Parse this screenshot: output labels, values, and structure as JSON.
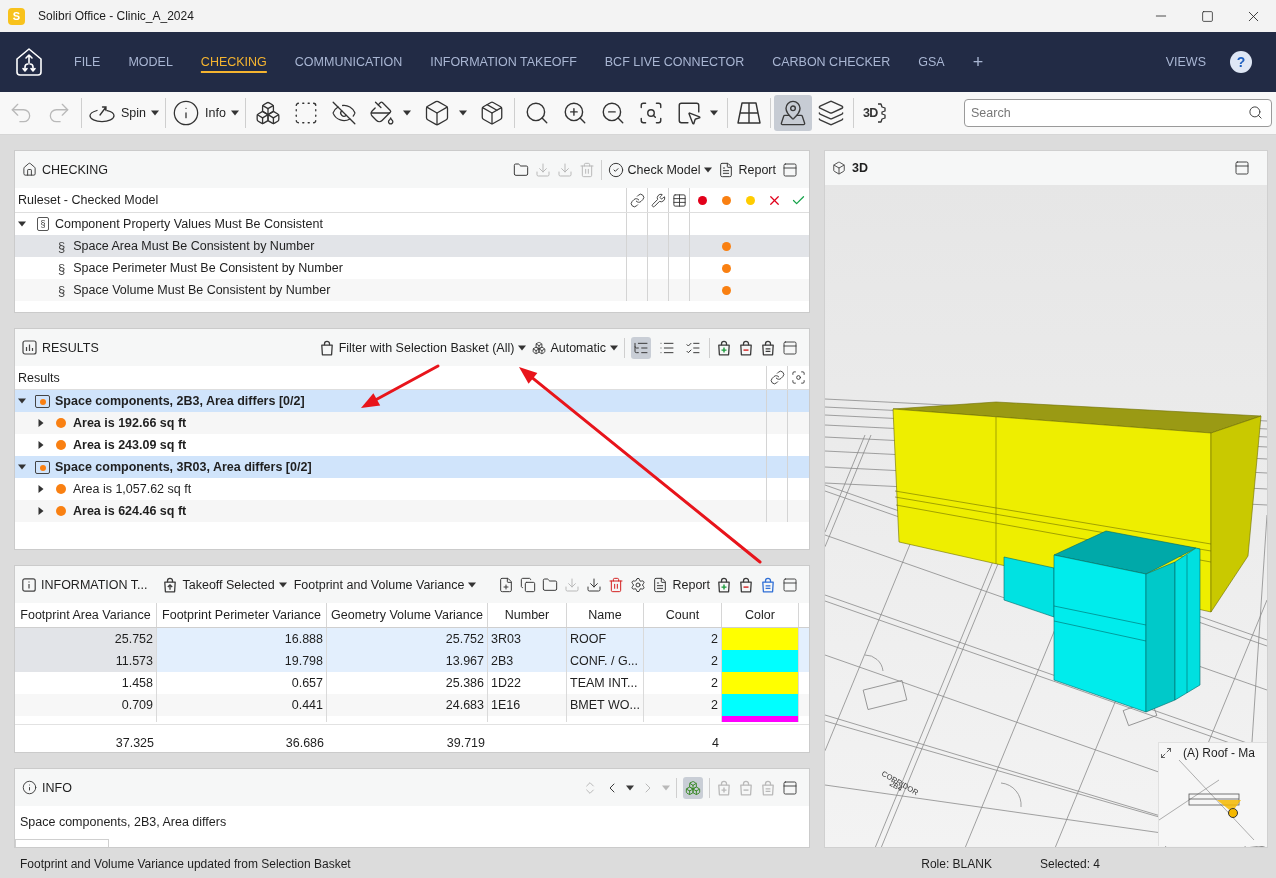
{
  "window": {
    "app_badge": "S",
    "title": "Solibri Office - Clinic_A_2024"
  },
  "menu": {
    "items": [
      {
        "label": "FILE",
        "selected": false
      },
      {
        "label": "MODEL",
        "selected": false
      },
      {
        "label": "CHECKING",
        "selected": true
      },
      {
        "label": "COMMUNICATION",
        "selected": false
      },
      {
        "label": "INFORMATION TAKEOFF",
        "selected": false
      },
      {
        "label": "BCF LIVE CONNECTOR",
        "selected": false
      },
      {
        "label": "CARBON CHECKER",
        "selected": false
      },
      {
        "label": "GSA",
        "selected": false
      }
    ],
    "add_tab": "+",
    "views": "VIEWS",
    "help": "?"
  },
  "toolbar": {
    "history": [
      {
        "disabled": true
      },
      {
        "disabled": true
      }
    ],
    "spin": {
      "label": "Spin"
    },
    "info": {
      "label": "Info"
    },
    "layout_tools": [
      {
        "selected": false
      },
      {
        "selected": true
      },
      {
        "selected": false
      }
    ],
    "view_settings": {
      "label": "3D"
    },
    "search": {
      "placeholder": "Search"
    }
  },
  "checking": {
    "title": "CHECKING",
    "file_actions": [
      {
        "disabled": false
      },
      {
        "disabled": true
      },
      {
        "disabled": true
      },
      {
        "disabled": true
      }
    ],
    "check_model": "Check Model",
    "report": "Report",
    "column": "Ruleset - Checked Model",
    "severity_columns": [
      {
        "color": "#e2001a"
      },
      {
        "color": "#f98012"
      },
      {
        "color": "#ffcc00"
      }
    ],
    "rulesets": [
      {
        "symbol": "§",
        "label": "Component Property Values Must Be Consistent",
        "expanded": true,
        "selected": false,
        "children": [
          {
            "symbol": "§",
            "label": "Space Area Must Be Consistent by Number",
            "selected": true,
            "color": "#f98012"
          },
          {
            "symbol": "§",
            "label": "Space Perimeter Must Be Consistent by Number",
            "selected": false,
            "color": "#f98012"
          },
          {
            "symbol": "§",
            "label": "Space Volume Must Be Consistent by Number",
            "selected": false,
            "color": "#f98012"
          }
        ]
      }
    ]
  },
  "results": {
    "title": "RESULTS",
    "filter": "Filter with Selection Basket (All)",
    "mode": "Automatic",
    "views": [
      {
        "selected": true
      },
      {
        "selected": false
      },
      {
        "selected": false
      }
    ],
    "basket": [
      {
        "disabled": false,
        "selected": false
      },
      {
        "disabled": false,
        "selected": false
      },
      {
        "disabled": false,
        "selected": false
      }
    ],
    "column": "Results",
    "groups": [
      {
        "label": "Space components, 2B3, Area differs [0/2]",
        "expanded": true,
        "selected": true,
        "color": "#f98012",
        "children": [
          {
            "label": "Area is 192.66 sq ft",
            "expanded": false,
            "unread": true,
            "color": "#f98012"
          },
          {
            "label": "Area is 243.09 sq ft",
            "expanded": false,
            "unread": true,
            "color": "#f98012"
          }
        ]
      },
      {
        "label": "Space components, 3R03, Area differs [0/2]",
        "expanded": true,
        "selected": true,
        "color": "#f98012",
        "children": [
          {
            "label": "Area is 1,057.62 sq ft",
            "expanded": false,
            "unread": false,
            "color": "#f98012"
          },
          {
            "label": "Area is 624.46 sq ft",
            "expanded": false,
            "unread": true,
            "color": "#f98012"
          }
        ]
      }
    ]
  },
  "takeoff": {
    "title": "INFORMATION T...",
    "source": "Takeoff Selected",
    "definition": "Footprint and Volume Variance",
    "tools": [
      {
        "disabled": false
      },
      {
        "disabled": false
      },
      {
        "disabled": false
      },
      {
        "disabled": true
      },
      {
        "disabled": false
      },
      {
        "disabled": false
      },
      {
        "disabled": false
      }
    ],
    "report": "Report",
    "basket": [
      {
        "disabled": false,
        "selected": false
      },
      {
        "disabled": false,
        "selected": false
      },
      {
        "disabled": false,
        "selected": true
      }
    ],
    "columns": [
      "Footprint Area Variance",
      "Footprint Perimeter Variance",
      "Geometry Volume Variance",
      "Number",
      "Name",
      "Count",
      "Color"
    ],
    "rows": [
      {
        "cells": [
          "25.752",
          "16.888",
          "25.752",
          "3R03",
          "ROOF",
          "2"
        ],
        "color": "#ffff00",
        "selected": true
      },
      {
        "cells": [
          "11.573",
          "19.798",
          "13.967",
          "2B3",
          "CONF. / G...",
          "2"
        ],
        "color": "#00ffff",
        "selected": true
      },
      {
        "cells": [
          "1.458",
          "0.657",
          "25.386",
          "1D22",
          "TEAM INT...",
          "2"
        ],
        "color": "#ffff00",
        "selected": false
      },
      {
        "cells": [
          "0.709",
          "0.441",
          "24.683",
          "1E16",
          "BMET WO...",
          "2"
        ],
        "color": "#00ffff",
        "selected": false
      }
    ],
    "clipped_row": {
      "color": "#ff00ff"
    },
    "totals": {
      "footprint_area_variance": "37.325",
      "footprint_perimeter_variance": "36.686",
      "geometry_volume_variance": "39.719",
      "count": "4"
    }
  },
  "info": {
    "title": "INFO",
    "nav": [
      {
        "disabled": true
      },
      {
        "disabled": false
      },
      {
        "disabled": false
      },
      {
        "disabled": true
      },
      {
        "disabled": true
      }
    ],
    "highlight": {
      "selected": true
    },
    "basket": [
      {
        "disabled": true
      },
      {
        "disabled": true
      },
      {
        "disabled": true
      }
    ],
    "text": "Space components, 2B3, Area differs"
  },
  "viewport": {
    "title": "3D",
    "floor_labels": [
      "CORRIDOR",
      "2B4"
    ],
    "minimap": {
      "title": "(A) Roof - Ma"
    }
  },
  "status_bar": {
    "message": "Footprint and Volume Variance updated from Selection Basket",
    "role": "Role: BLANK",
    "selection": "Selected: 4"
  }
}
